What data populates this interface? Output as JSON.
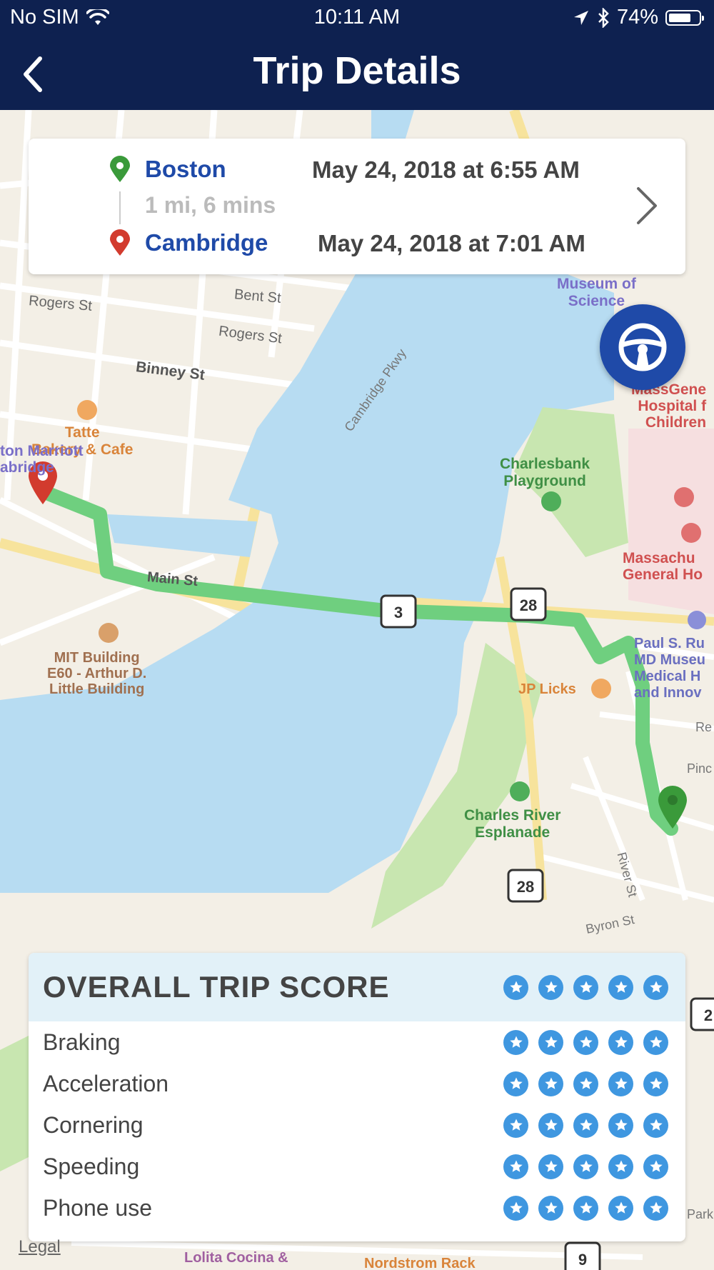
{
  "status_bar": {
    "carrier": "No SIM",
    "time": "10:11 AM",
    "battery": "74%",
    "battery_level": 0.74
  },
  "nav": {
    "title": "Trip Details"
  },
  "trip": {
    "origin": {
      "city": "Boston",
      "timestamp": "May 24, 2018 at 6:55 AM"
    },
    "summary": "1 mi, 6 mins",
    "destination": {
      "city": "Cambridge",
      "timestamp": "May 24, 2018 at 7:01 AM"
    }
  },
  "map": {
    "labels": {
      "museum": "Museum of\nScience",
      "rogers1": "Rogers St",
      "bent": "Bent St",
      "rogers2": "Rogers St",
      "binney": "Binney St",
      "cambridge_pkwy": "Cambridge Pkwy",
      "tatte": "Tatte\nBakery & Cafe",
      "marriott": "ton Marriott\nabridge",
      "massgen": "MassGene\nHospital f\nChildren",
      "charlesbank": "Charlesbank\nPlayground",
      "massachu": "Massachu\nGeneral Ho",
      "main_st": "Main St",
      "paul": "Paul S. Ru\nMD Museu\nMedical H\nand Innov",
      "mit": "MIT Building\nE60 - Arthur D.\nLittle Building",
      "jplicks": "JP Licks",
      "re": "Re",
      "pinc": "Pinc",
      "esplanade": "Charles River\nEsplanade",
      "river_st": "River St",
      "byron": "Byron St",
      "park": "Park",
      "lolita": "Lolita Cocina &",
      "nordstrom": "Nordstrom Rack"
    },
    "route_shields": [
      "3",
      "28",
      "28",
      "9",
      "2"
    ],
    "legal": "Legal"
  },
  "score": {
    "title": "OVERALL TRIP SCORE",
    "overall_stars": 5,
    "rows": [
      {
        "label": "Braking",
        "stars": 5
      },
      {
        "label": "Acceleration",
        "stars": 5
      },
      {
        "label": "Cornering",
        "stars": 5
      },
      {
        "label": "Speeding",
        "stars": 5
      },
      {
        "label": "Phone use",
        "stars": 5
      }
    ]
  },
  "colors": {
    "nav_bg": "#0e2150",
    "accent": "#1f4aa8",
    "route": "#6fcf7f",
    "water": "#b7dcf2",
    "park": "#c8e6b0",
    "star": "#3f97e0",
    "origin_pin": "#3a9a3a",
    "destination_pin": "#d23b2e"
  },
  "icons": {
    "back": "chevron-left-icon",
    "wifi": "wifi-icon",
    "location": "location-arrow-icon",
    "bluetooth": "bluetooth-icon",
    "steering": "steering-wheel-icon",
    "star": "star-icon",
    "pin": "map-pin-icon",
    "chevron": "chevron-right-icon"
  }
}
